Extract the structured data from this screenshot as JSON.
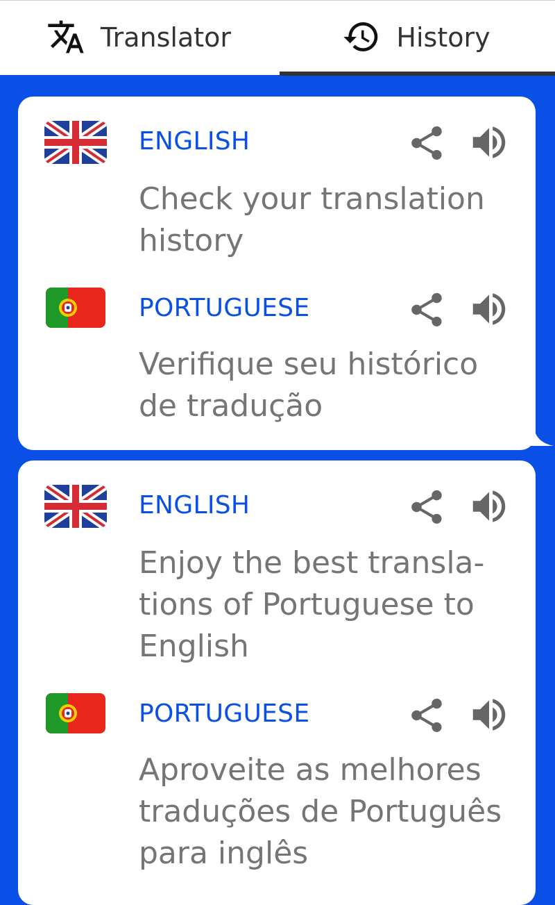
{
  "tabs": {
    "translator": {
      "label": "Translator",
      "icon": "translate-icon"
    },
    "history": {
      "label": "History",
      "icon": "history-icon",
      "selected": true
    }
  },
  "cards": [
    {
      "entries": [
        {
          "language": "ENGLISH",
          "flag": "uk-flag-icon",
          "text_lines": [
            "Check your translation",
            "history"
          ]
        },
        {
          "language": "PORTUGUESE",
          "flag": "portugal-flag-icon",
          "text_lines": [
            "Verifique seu histórico",
            "de tradução"
          ]
        }
      ]
    },
    {
      "entries": [
        {
          "language": "ENGLISH",
          "flag": "uk-flag-icon",
          "text_lines": [
            "Enjoy the best transla-",
            "tions of Portuguese to",
            "English"
          ]
        },
        {
          "language": "PORTUGUESE",
          "flag": "portugal-flag-icon",
          "text_lines": [
            "Aproveite as melhores",
            "traduções de Português",
            "para inglês"
          ]
        }
      ]
    }
  ],
  "colors": {
    "accent": "#0a50e6",
    "text_muted": "#757575",
    "icon_grey": "#666666"
  }
}
